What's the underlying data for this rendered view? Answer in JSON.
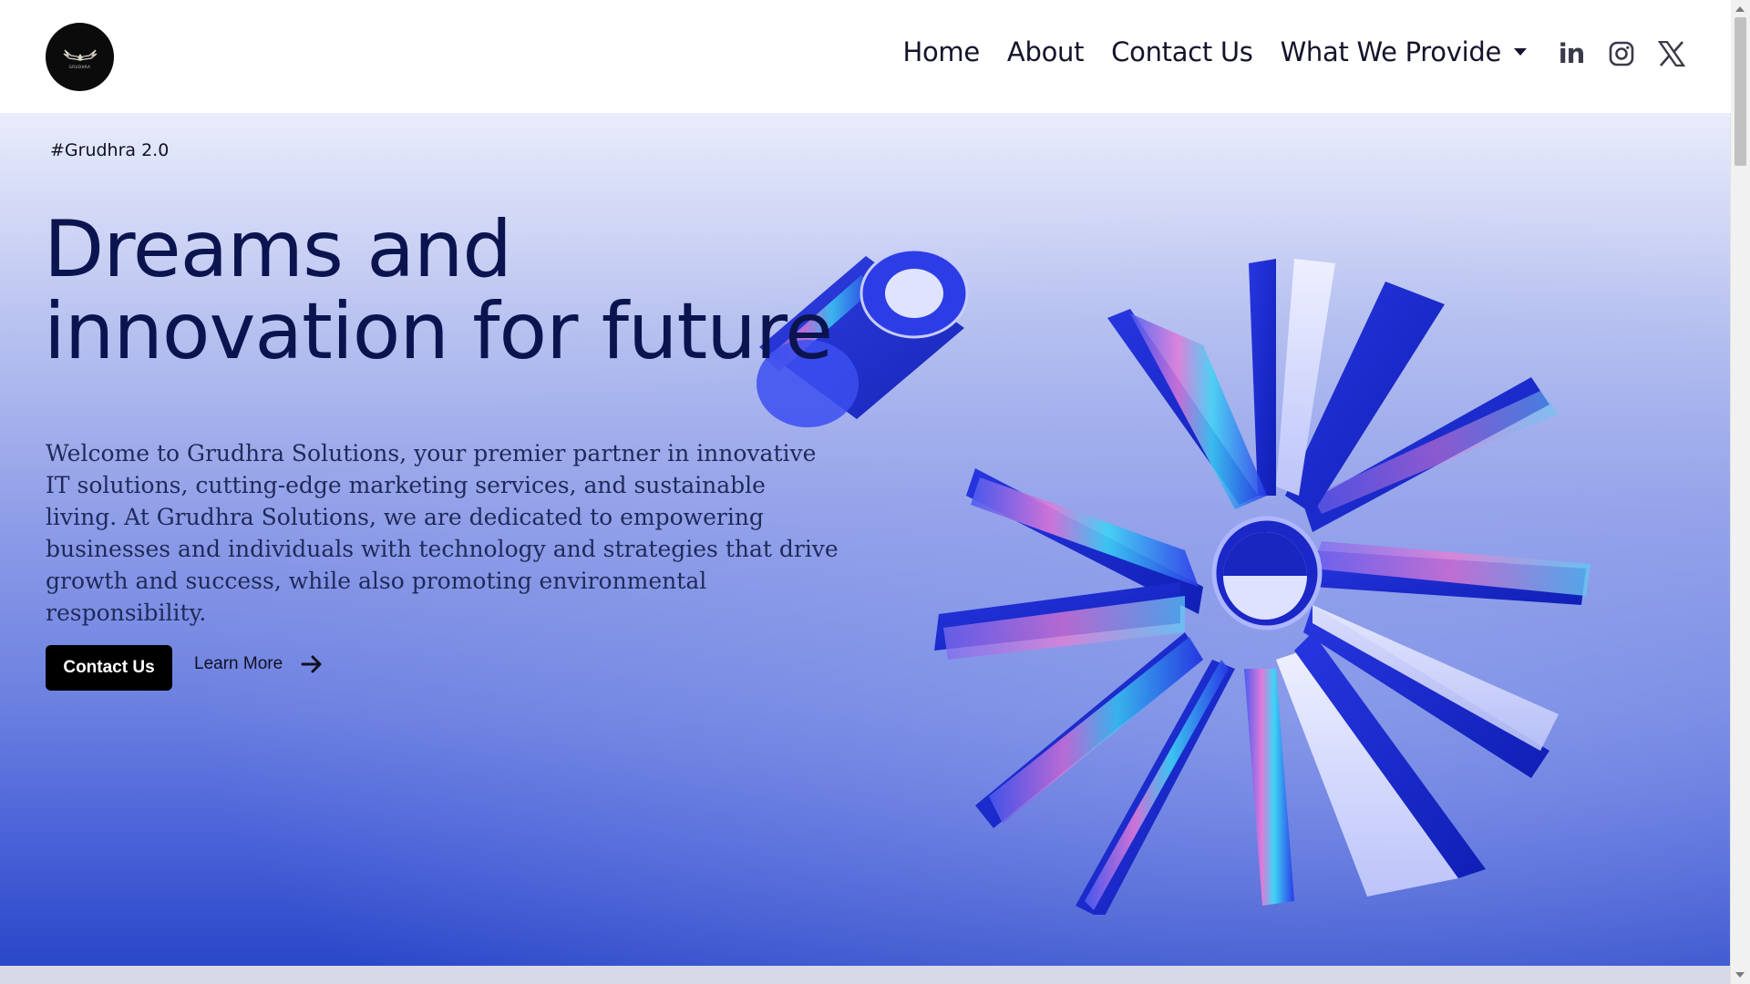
{
  "brand": {
    "logo_text": "GRUDHRA",
    "logo_icon": "wings-icon"
  },
  "nav": {
    "items": [
      {
        "label": "Home"
      },
      {
        "label": "About"
      },
      {
        "label": "Contact Us"
      },
      {
        "label": "What We Provide",
        "has_dropdown": true
      }
    ]
  },
  "socials": [
    {
      "name": "linkedin-icon",
      "glyph": "in"
    },
    {
      "name": "instagram-icon"
    },
    {
      "name": "x-icon"
    }
  ],
  "hero": {
    "tag": "#Grudhra 2.0",
    "headline_line1": "Dreams and",
    "headline_line2": "innovation for future",
    "description": "Welcome to Grudhra Solutions, your premier partner in innovative IT solutions, cutting-edge marketing services, and sustainable living. At Grudhra Solutions, we are dedicated to empowering businesses and individuals with technology and strategies that drive growth and success, while also promoting environmental responsibility.",
    "primary_button": "Contact Us",
    "secondary_link": "Learn More"
  },
  "colors": {
    "headline": "#0c1450",
    "button_bg": "#000000",
    "hero_gradient_top": "#e9ecfb",
    "hero_gradient_bottom": "#2a47c9",
    "accent_blue": "#1e2fd0"
  }
}
